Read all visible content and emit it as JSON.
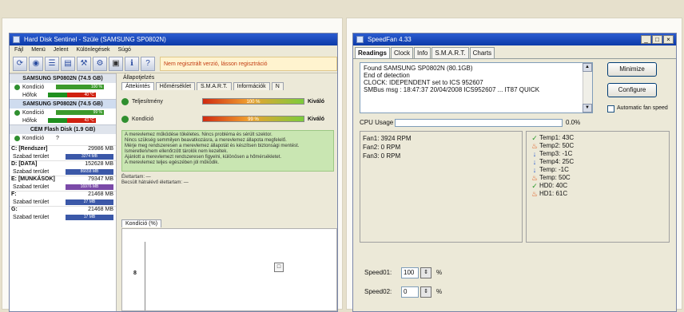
{
  "left_window": {
    "title": "Hard Disk Sentinel - Szüle (SAMSUNG SP0802N)",
    "menu": [
      "Fájl",
      "Menü",
      "Jelent",
      "Különlegések",
      "Súgó"
    ],
    "toolbar_message": "Nem regisztrált verzió, lásson regisztráció",
    "disks": [
      {
        "name": "SAMSUNG SP0802N",
        "size": "(74.5 GB)",
        "selected": false,
        "rows": [
          {
            "label": "Kondíció",
            "bar": "100 %",
            "bar_style": "green"
          },
          {
            "label": "Hőfok",
            "bar": "40 °C",
            "bar_style": "red"
          }
        ]
      },
      {
        "name": "SAMSUNG SP0802N",
        "size": "(74.5 GB)",
        "selected": true,
        "rows": [
          {
            "label": "Kondíció",
            "bar": "99 %",
            "bar_style": "green"
          },
          {
            "label": "Hőfok",
            "bar": "43 °C",
            "bar_style": "red"
          }
        ]
      },
      {
        "name": "CEM Flash Disk",
        "size": "(1.9 GB)",
        "selected": false,
        "rows": [
          {
            "label": "Kondíció",
            "bar": "?",
            "bar_style": "none"
          }
        ]
      }
    ],
    "volumes": [
      {
        "name": "C: [Rendszer]",
        "size": "29986 MB",
        "free_label": "Szabad terület",
        "free": "3274 MB",
        "bar_style": "blue"
      },
      {
        "name": "D: [DATA]",
        "size": "152628 MB",
        "free_label": "Szabad terület",
        "free": "86658 MB",
        "bar_style": "blue"
      },
      {
        "name": "E: [MUNKÁSOK]",
        "size": "79347 MB",
        "free_label": "Szabad terület",
        "free": "16976 MB",
        "bar_style": "purple"
      },
      {
        "name": "F:",
        "size": "21468 MB",
        "free_label": "Szabad terület",
        "free": "27 MB",
        "bar_style": "blue"
      },
      {
        "name": "G:",
        "size": "21468 MB",
        "free_label": "Szabad terület",
        "free": "17 MB",
        "bar_style": "blue"
      }
    ],
    "section_label": "Állapotjelzés",
    "tabs": [
      "Áttekintés",
      "Hőmérséklet",
      "S.M.A.R.T.",
      "Információk",
      "N"
    ],
    "gauges": [
      {
        "label": "Teljesítmény",
        "value": "100 %",
        "status": "Kiváló"
      },
      {
        "label": "Kondíció",
        "value": "99 %",
        "status": "Kiváló"
      }
    ],
    "info_text": [
      "A merevlemez működése tökéletes. Nincs probléma és sérült szektor.",
      "Nincs szükség semmilyen beavatkozásra, a merevlemez állapota megfelelő.",
      "Mérje meg rendszeresen a merevlemez állapotát és készítsen biztonsági mentést.",
      "Ismeretlen/nem ellenőrzött tárolók nem kezeltek.",
      "Ajánlott a merevlemezt rendszeresen figyelni, különösen a hőmérsékletet.",
      "A merevlemez teljes egészében jól működik."
    ],
    "status_lines": [
      "Élettartam: —",
      "Becsült hátralévő élettartam: —"
    ],
    "chart_tab": "Kondíció (%)",
    "chart_ylabel": "8",
    "chart_marker": "□"
  },
  "right_window": {
    "title": "SpeedFan 4.33",
    "window_buttons": [
      "_",
      "□",
      "×"
    ],
    "tabs": [
      "Readings",
      "Clock",
      "Info",
      "S.M.A.R.T.",
      "Charts"
    ],
    "log_lines": [
      "Found SAMSUNG SP0802N (80.1GB)",
      "End of detection",
      "CLOCK: IDEPENDENT set to ICS 952607",
      "SMBus msg : 18:47:37 20/04/2008 ICS952607 ... IT87 QUICK"
    ],
    "buttons": {
      "minimize": "Minimize",
      "configure": "Configure"
    },
    "auto_fan_label": "Automatic fan speed",
    "cpu_usage_label": "CPU Usage",
    "cpu_usage_value": "0.0%",
    "fans": [
      "Fan1: 3924 RPM",
      "Fan2: 0 RPM",
      "Fan3: 0 RPM"
    ],
    "temps": [
      {
        "icon": "check-icon",
        "text": "Temp1: 43C"
      },
      {
        "icon": "flame-icon",
        "text": "Temp2: 50C"
      },
      {
        "icon": "arrow-down-icon",
        "text": "Temp3: -1C"
      },
      {
        "icon": "arrow-down-icon",
        "text": "Temp4: 25C"
      },
      {
        "icon": "arrow-down-icon",
        "text": "Temp: -1C"
      },
      {
        "icon": "flame-icon",
        "text": "Temp: 50C"
      },
      {
        "icon": "check-icon",
        "text": "HD0: 40C"
      },
      {
        "icon": "flame-icon",
        "text": "HD1: 61C"
      }
    ],
    "speeds": [
      {
        "label": "Speed01:",
        "value": "100",
        "unit": "%"
      },
      {
        "label": "Speed02:",
        "value": "0",
        "unit": "%"
      }
    ]
  }
}
